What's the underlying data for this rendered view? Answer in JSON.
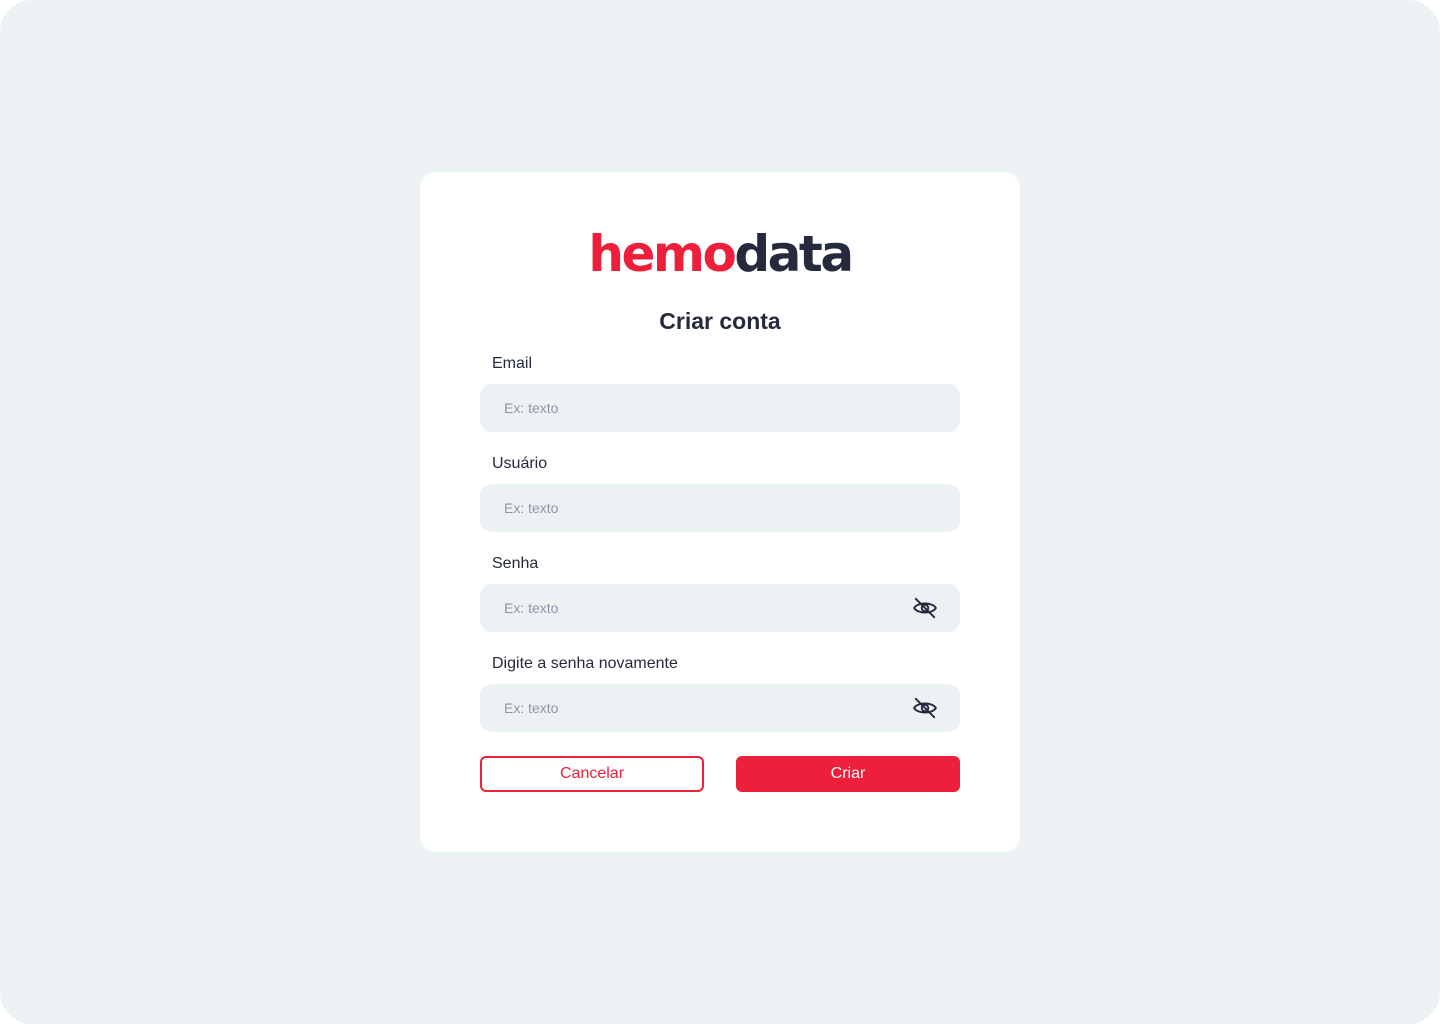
{
  "brand": {
    "logo_part1": "hemo",
    "logo_part2": "data",
    "primary_color": "#ee1f3a",
    "dark_color": "#262a3d"
  },
  "form": {
    "title": "Criar conta",
    "fields": [
      {
        "label": "Email",
        "placeholder": "Ex: texto",
        "value": ""
      },
      {
        "label": "Usuário",
        "placeholder": "Ex: texto",
        "value": ""
      },
      {
        "label": "Senha",
        "placeholder": "Ex: texto",
        "value": "",
        "icon": "eye-off-icon"
      },
      {
        "label": "Digite a senha novamente",
        "placeholder": "Ex: texto",
        "value": "",
        "icon": "eye-off-icon"
      }
    ],
    "cancel_label": "Cancelar",
    "submit_label": "Criar"
  }
}
